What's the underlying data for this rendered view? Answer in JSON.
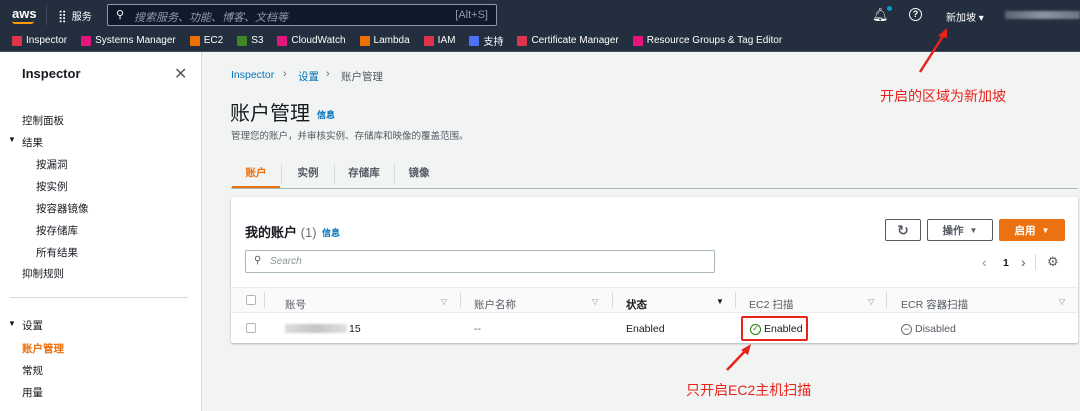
{
  "topbar": {
    "logo": "aws",
    "services": "服务",
    "search_placeholder": "搜索服务、功能、博客、文档等",
    "search_shortcut": "[Alt+S]",
    "region": "新加坡"
  },
  "favorites": [
    {
      "label": "Inspector",
      "color": "#dd344c"
    },
    {
      "label": "Systems Manager",
      "color": "#e7157b"
    },
    {
      "label": "EC2",
      "color": "#ed7100"
    },
    {
      "label": "S3",
      "color": "#3f8624"
    },
    {
      "label": "CloudWatch",
      "color": "#e7157b"
    },
    {
      "label": "Lambda",
      "color": "#ed7100"
    },
    {
      "label": "IAM",
      "color": "#dd344c"
    },
    {
      "label": "支持",
      "color": "#4d72f3"
    },
    {
      "label": "Certificate Manager",
      "color": "#dd344c"
    },
    {
      "label": "Resource Groups & Tag Editor",
      "color": "#e7157b"
    }
  ],
  "sidebar": {
    "title": "Inspector",
    "items": [
      "控制面板",
      "结果",
      "按漏洞",
      "按实例",
      "按容器镜像",
      "按存储库",
      "所有结果",
      "抑制规则",
      "设置",
      "账户管理",
      "常规",
      "用量"
    ]
  },
  "breadcrumb": [
    "Inspector",
    "设置",
    "账户管理"
  ],
  "page": {
    "title": "账户管理",
    "info": "信息",
    "description": "管理您的账户，并审核实例、存储库和映像的覆盖范围。"
  },
  "tabs": [
    "账户",
    "实例",
    "存储库",
    "镜像"
  ],
  "card": {
    "title": "我的账户",
    "count": "(1)",
    "info": "信息",
    "refresh": "↻",
    "actions": "操作",
    "enable": "启用",
    "search_placeholder": "Search",
    "page": "1"
  },
  "table": {
    "headers": [
      "账号",
      "账户名称",
      "状态",
      "EC2 扫描",
      "ECR 容器扫描"
    ],
    "rows": [
      {
        "account": "15",
        "name": "--",
        "status": "Enabled",
        "ec2": "Enabled",
        "ecr": "Disabled"
      }
    ]
  },
  "annotations": {
    "region": "开启的区域为新加坡",
    "ec2": "只开启EC2主机扫描"
  }
}
